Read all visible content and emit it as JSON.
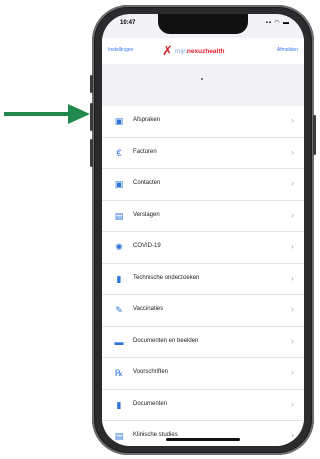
{
  "status": {
    "time": "10:47",
    "icons": "▪▪ ◠ ▬"
  },
  "header": {
    "left": "Instellingen",
    "right": "Afmelden"
  },
  "logo": {
    "mark": "✗",
    "muted": "mijn",
    "brand": "nexuzhealth"
  },
  "menu": [
    {
      "label": "Afspraken",
      "icon": "calendar-icon",
      "glyph": "▣"
    },
    {
      "label": "Facturen",
      "icon": "euro-icon",
      "glyph": "€"
    },
    {
      "label": "Contacten",
      "icon": "calendar-icon",
      "glyph": "▣"
    },
    {
      "label": "Verslagen",
      "icon": "report-icon",
      "glyph": "▤"
    },
    {
      "label": "COVID-19",
      "icon": "virus-icon",
      "glyph": "✺"
    },
    {
      "label": "Technische onderzoeken",
      "icon": "document-icon",
      "glyph": "▮"
    },
    {
      "label": "Vaccinaties",
      "icon": "syringe-icon",
      "glyph": "✎"
    },
    {
      "label": "Documenten en beelden",
      "icon": "folder-icon",
      "glyph": "▬"
    },
    {
      "label": "Voorschriften",
      "icon": "prescription-icon",
      "glyph": "℞"
    },
    {
      "label": "Documenten",
      "icon": "file-icon",
      "glyph": "▮"
    },
    {
      "label": "Klinische studies",
      "icon": "clipboard-icon",
      "glyph": "▤"
    }
  ],
  "chevron": "›",
  "colors": {
    "accent": "#2c74d8",
    "arrow": "#1f8a4c",
    "brand": "#e6202f"
  }
}
